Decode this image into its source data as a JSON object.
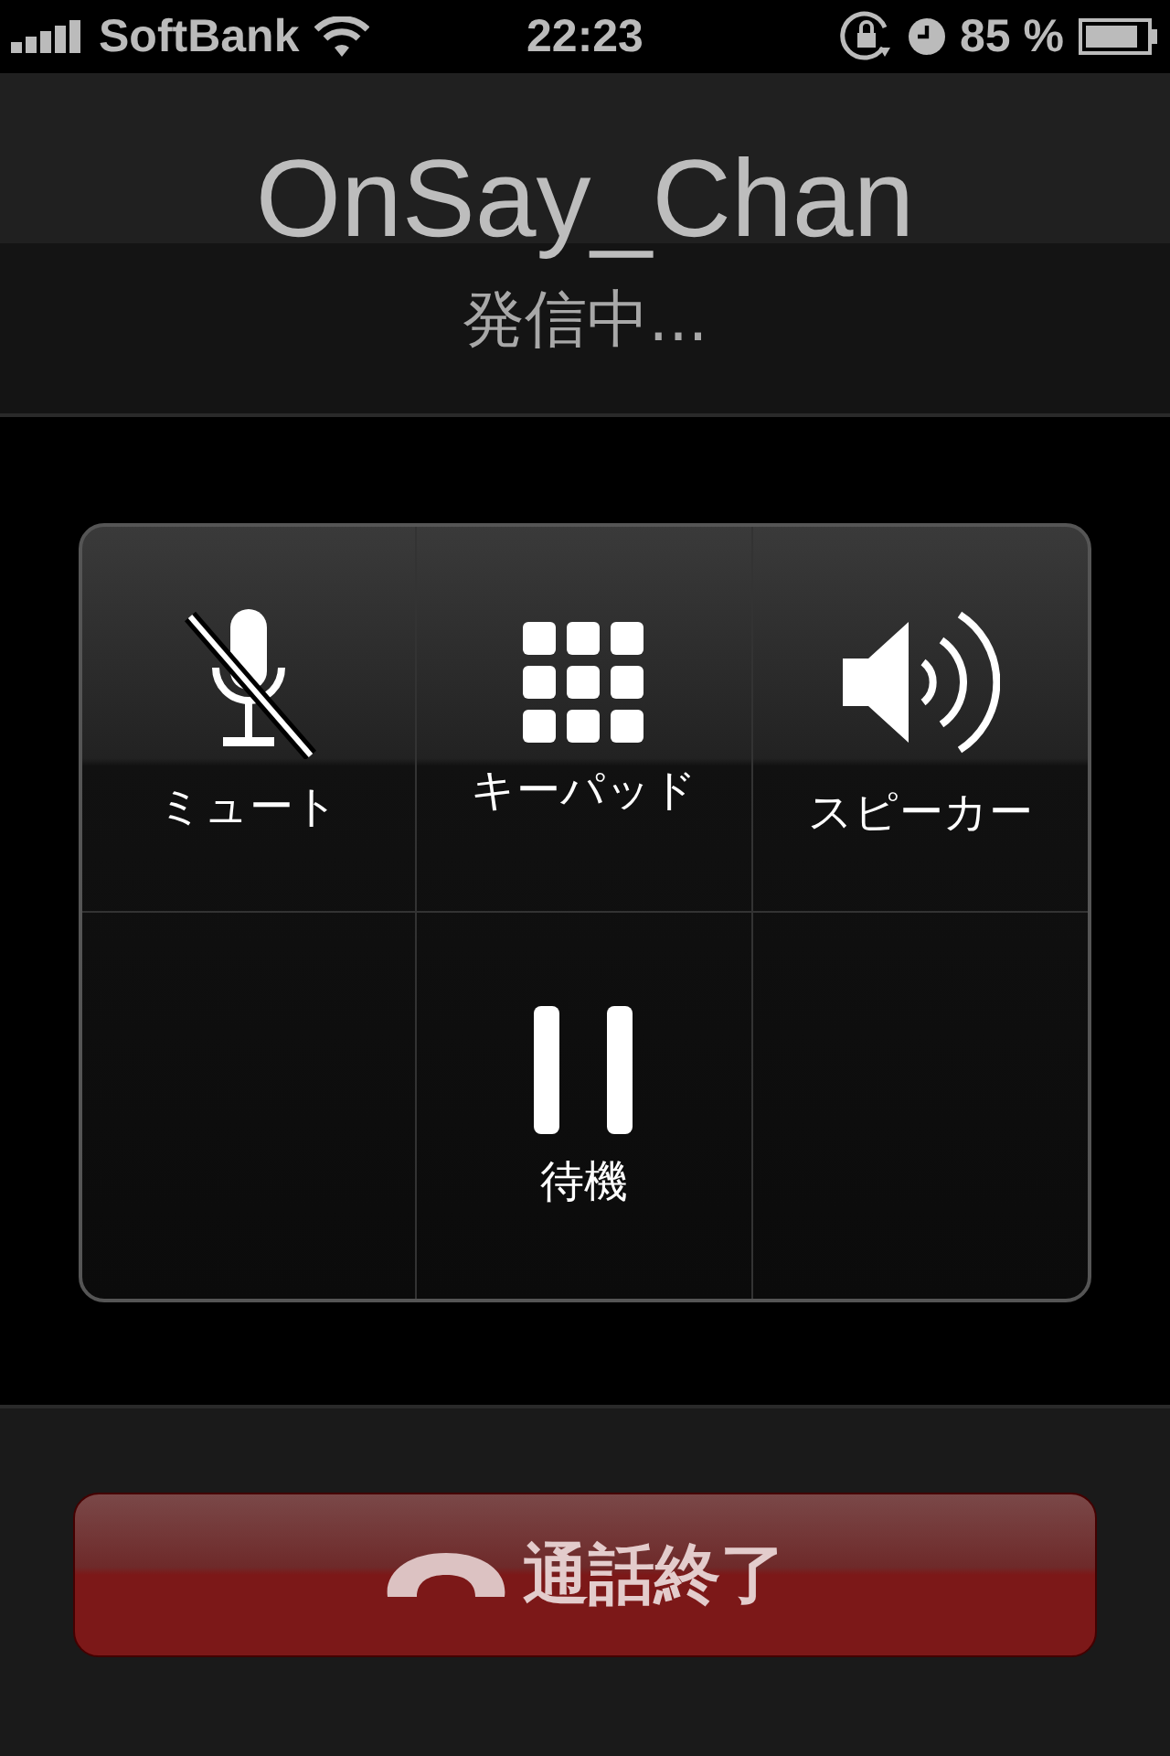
{
  "status_bar": {
    "carrier": "SoftBank",
    "time": "22:23",
    "battery": "85 %"
  },
  "caller": {
    "name": "OnSay_Chan",
    "status": "発信中..."
  },
  "buttons": [
    {
      "kind": "mute",
      "label": "ミュート"
    },
    {
      "kind": "keypad",
      "label": "キーパッド"
    },
    {
      "kind": "speaker",
      "label": "スピーカー"
    },
    {
      "kind": "empty"
    },
    {
      "kind": "hold",
      "label": "待機"
    },
    {
      "kind": "empty"
    }
  ],
  "end_call": {
    "label": "通話終了"
  }
}
